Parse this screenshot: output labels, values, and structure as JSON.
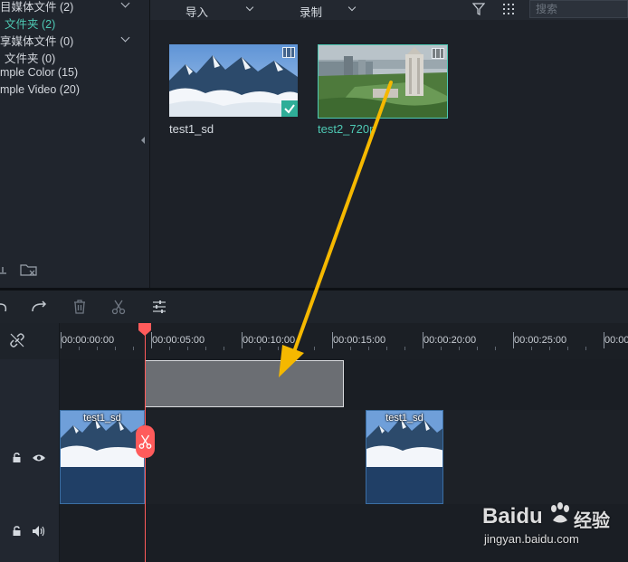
{
  "media_tree": {
    "items": [
      {
        "label": "目媒体文件 (2)",
        "active": false
      },
      {
        "label": "文件夹 (2)",
        "active": true
      },
      {
        "label": "享媒体文件 (0)",
        "active": false
      },
      {
        "label": "文件夹 (0)",
        "active": false
      },
      {
        "label": "mple Color (15)",
        "active": false
      },
      {
        "label": "mple Video (20)",
        "active": false
      }
    ],
    "bottom_icons": [
      "add-folder-icon",
      "delete-folder-icon"
    ]
  },
  "toolbar": {
    "import_label": "导入",
    "record_label": "录制",
    "filter_icon": "filter-icon",
    "grid_icon": "grid-view-icon",
    "search_placeholder": "搜索"
  },
  "media": {
    "items": [
      {
        "name": "test1_sd",
        "used": true
      },
      {
        "name": "test2_720p",
        "used": false
      }
    ]
  },
  "timeline_tools": [
    "undo-icon",
    "redo-icon",
    "delete-icon",
    "split-icon",
    "adjust-icon"
  ],
  "ruler": {
    "labels": [
      "00:00:00:00",
      "00:00:05:00",
      "00:00:10:00",
      "00:00:15:00",
      "00:00:20:00",
      "00:00:25:00",
      "00:00:30:00"
    ]
  },
  "tracks": {
    "video": {
      "clips": [
        {
          "title": "test1_sd"
        },
        {
          "title": "test1_sd"
        }
      ]
    }
  },
  "watermark": {
    "brand": "Baidu",
    "cn": "经验",
    "url": "jingyan.baidu.com"
  },
  "colors": {
    "accent": "#4ec9b4",
    "playhead": "#ff5b5b",
    "arrow": "#f5b800",
    "clip_audio": "#203f66"
  }
}
